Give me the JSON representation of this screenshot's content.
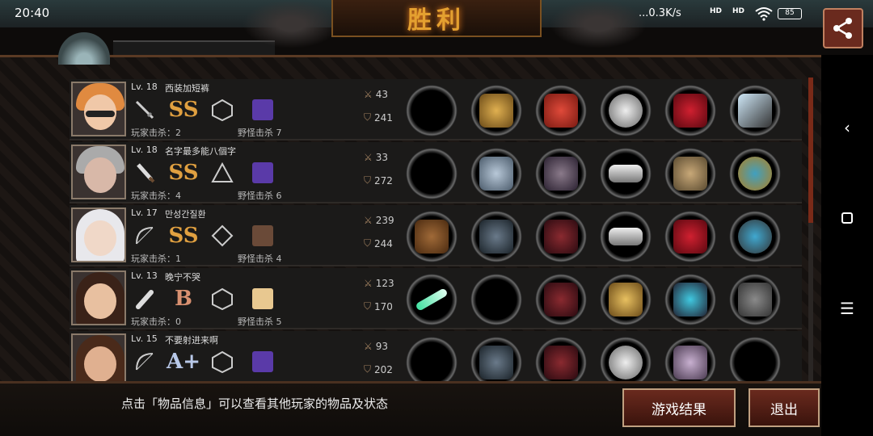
{
  "status_bar": {
    "time": "20:40",
    "network": "...0.3K/s",
    "signal_1": "HD",
    "signal_2": "HD",
    "battery": "85"
  },
  "banner": {
    "title": "胜利"
  },
  "players": [
    {
      "level": "Lv. 18",
      "name": "西装加短裤",
      "rank": "SS",
      "kills": "玩家击杀：2",
      "monster_kills": "野怪击杀 7",
      "attack": "43",
      "defense": "241",
      "weapon": "sword-icon"
    },
    {
      "level": "Lv. 18",
      "name": "名字最多能八個字",
      "rank": "SS",
      "kills": "玩家击杀：4",
      "monster_kills": "野怪击杀 6",
      "attack": "33",
      "defense": "272",
      "weapon": "knife-icon"
    },
    {
      "level": "Lv. 17",
      "name": "만성간질환",
      "rank": "SS",
      "kills": "玩家击杀：1",
      "monster_kills": "野怪击杀 4",
      "attack": "239",
      "defense": "244",
      "weapon": "bow-icon"
    },
    {
      "level": "Lv. 13",
      "name": "晚宁不哭",
      "rank": "B",
      "kills": "玩家击杀：0",
      "monster_kills": "野怪击杀 5",
      "attack": "123",
      "defense": "170",
      "weapon": "bat-icon"
    },
    {
      "level": "Lv. 15",
      "name": "不要射进来啊",
      "rank": "A+",
      "kills": "",
      "monster_kills": "",
      "attack": "93",
      "defense": "202",
      "weapon": "bow-icon"
    }
  ],
  "footer": {
    "hint": "点击「物品信息」可以查看其他玩家的物品及状态",
    "results_button": "游戏结果",
    "exit_button": "退出"
  },
  "colors": {
    "accent": "#e4a030",
    "button_bg": "#6a2a1e",
    "panel": "#1b1a19"
  }
}
